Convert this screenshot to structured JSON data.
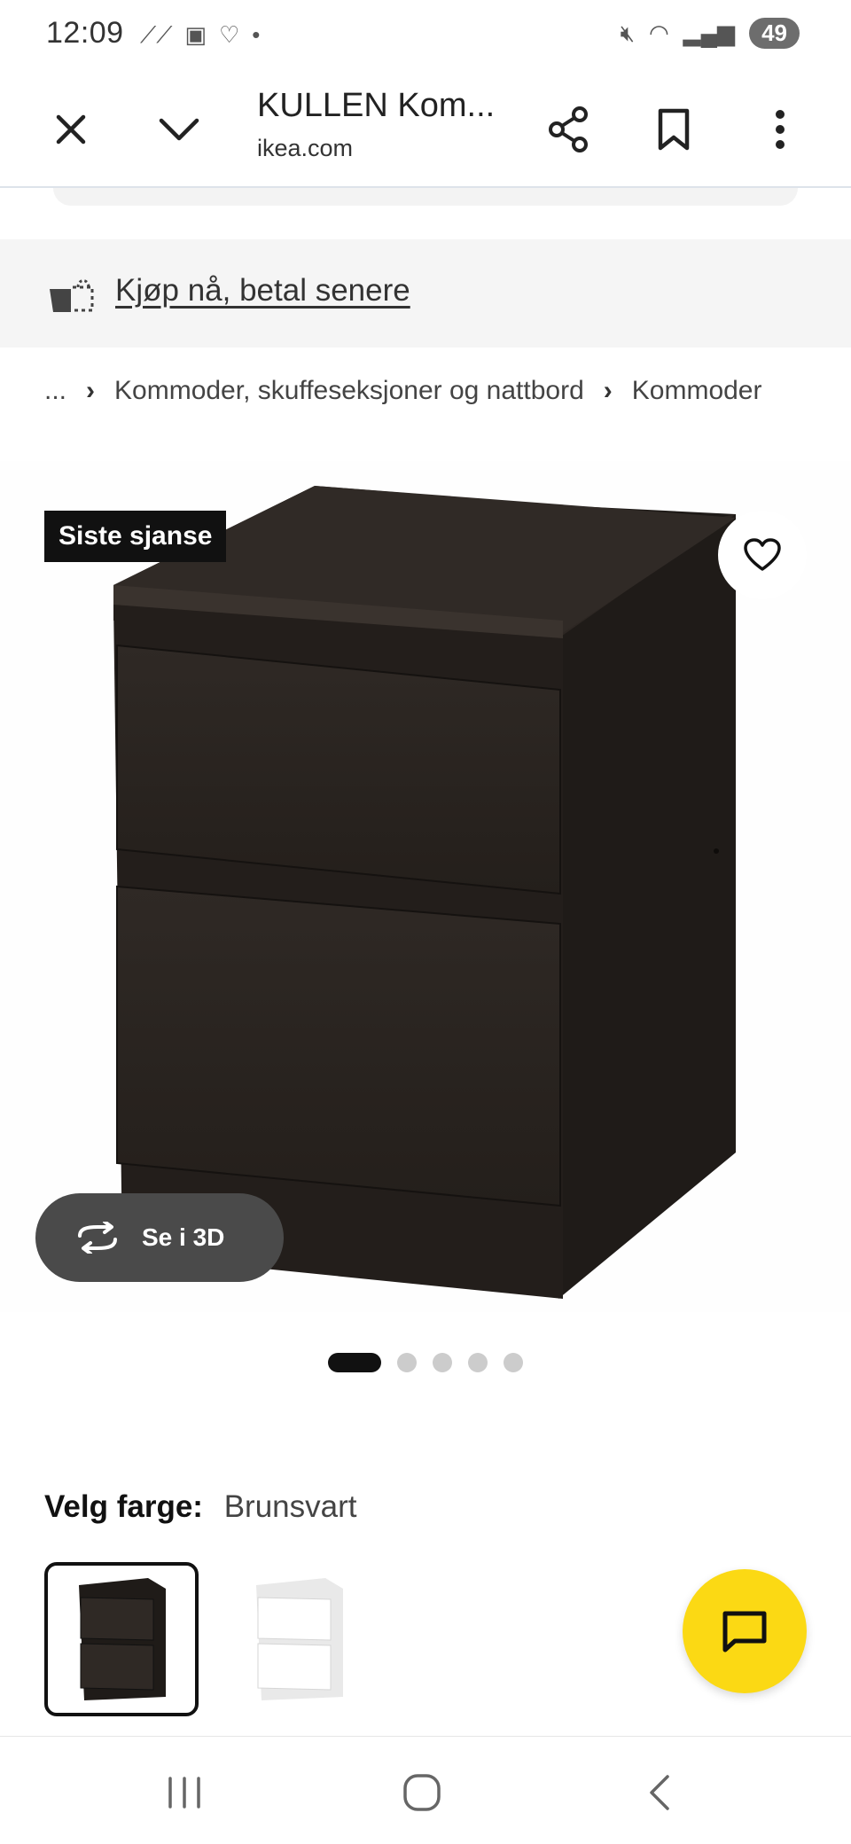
{
  "status_bar": {
    "time": "12:09",
    "left_icons": [
      "missed-call-icon",
      "news-app-icon",
      "heart-app-icon",
      "dot-icon"
    ],
    "battery": "49",
    "right_icons": [
      "mute-icon",
      "wifi-icon",
      "signal-icon"
    ]
  },
  "browser": {
    "title": "KULLEN Kom...",
    "url": "ikea.com",
    "buttons": [
      "close-icon",
      "chevron-down-icon",
      "share-icon",
      "bookmark-icon",
      "more-vert-icon"
    ]
  },
  "bnpl": {
    "label": "Kjøp nå, betal senere"
  },
  "breadcrumb": {
    "items": [
      "...",
      "Kommoder, skuffeseksjoner og nattbord",
      "Kommoder"
    ]
  },
  "product": {
    "badge": "Siste sjanse",
    "view3d_label": "Se i 3D",
    "gallery_dots": 5,
    "gallery_active_index": 0
  },
  "color_selector": {
    "label": "Velg farge:",
    "selected_value": "Brunsvart",
    "options": [
      {
        "name": "Brunsvart",
        "color": "#2a2420",
        "selected": true
      },
      {
        "name": "Hvit",
        "color": "#f4f4f4",
        "selected": false
      }
    ]
  },
  "colors": {
    "accent_yellow": "#fbd914",
    "badge_black": "#111111",
    "furniture_brown_black": "#2a2420"
  },
  "nav_bar": {
    "buttons": [
      "recents-icon",
      "home-icon",
      "back-icon"
    ]
  }
}
